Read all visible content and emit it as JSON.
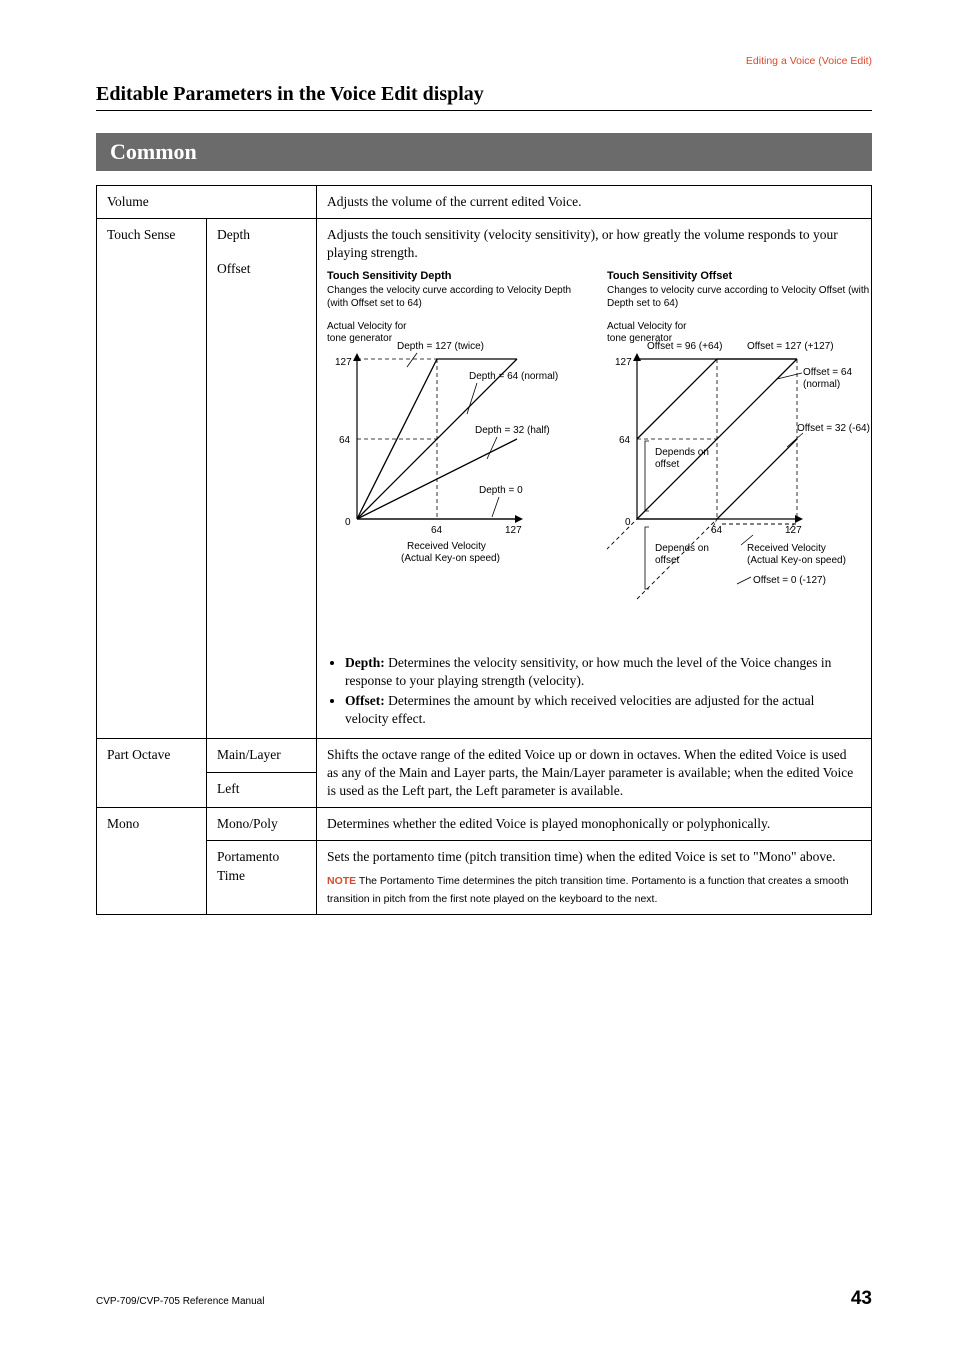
{
  "header": {
    "breadcrumb": "Editing a Voice (Voice Edit)"
  },
  "section_title": "Editable Parameters in the Voice Edit display",
  "common_bar": "Common",
  "table": {
    "volume": {
      "label": "Volume",
      "desc": "Adjusts the volume of the current edited Voice."
    },
    "touch_sense": {
      "label": "Touch Sense",
      "depth_label": "Depth",
      "offset_label": "Offset",
      "intro": "Adjusts the touch sensitivity (velocity sensitivity), or how greatly the volume responds to your playing strength.",
      "diag_left": {
        "title": "Touch Sensitivity Depth",
        "sub": "Changes the velocity curve according to Velocity Depth (with Offset set to 64)",
        "ylabel": "Actual Velocity for\ntone generator",
        "xlabel": "Received Velocity\n(Actual Key-on speed)",
        "ticks_y": [
          "127",
          "64",
          "0"
        ],
        "ticks_x": [
          "64",
          "127"
        ],
        "curves": [
          "Depth = 127 (twice)",
          "Depth = 64 (normal)",
          "Depth = 32 (half)",
          "Depth = 0"
        ]
      },
      "diag_right": {
        "title": "Touch Sensitivity Offset",
        "sub": "Changes to velocity curve according to Velocity Offset (with Depth set to 64)",
        "ylabel": "Actual Velocity for\ntone generator",
        "xlabel": "Received Velocity\n(Actual Key-on speed)",
        "ticks_y": [
          "127",
          "64",
          "0"
        ],
        "ticks_x": [
          "64",
          "127"
        ],
        "curves": [
          "Offset = 96 (+64)",
          "Offset = 127 (+127)",
          "Offset = 64 (normal)",
          "Offset = 32 (-64)",
          "Offset = 0 (-127)"
        ],
        "depends": "Depends on offset"
      },
      "bullets": {
        "depth_b": "Depth:",
        "depth_t": " Determines the velocity sensitivity, or how much the level of the Voice changes in response to your playing strength (velocity).",
        "offset_b": "Offset:",
        "offset_t": " Determines the amount by which received velocities are adjusted for the actual velocity effect."
      }
    },
    "part_octave": {
      "label": "Part Octave",
      "main_layer": "Main/Layer",
      "left": "Left",
      "desc": "Shifts the octave range of the edited Voice up or down in octaves. When the edited Voice is used as any of the Main and Layer parts, the Main/Layer parameter is available; when the edited Voice is used as the Left part, the Left parameter is available."
    },
    "mono": {
      "label": "Mono",
      "monopoly": "Mono/Poly",
      "monopoly_desc": "Determines whether the edited Voice is played monophonically or polyphonically.",
      "port": "Portamento Time",
      "port_desc": "Sets the portamento time (pitch transition time) when the edited Voice is set to \"Mono\" above.",
      "note_label": "NOTE",
      "note_body": " The Portamento Time determines the pitch transition time. Portamento is a function that creates a smooth transition in pitch from the first note played on the keyboard to the next."
    }
  },
  "footer": {
    "left": "CVP-709/CVP-705 Reference Manual",
    "right": "43"
  },
  "chart_data": [
    {
      "type": "line",
      "title": "Touch Sensitivity Depth",
      "subtitle": "Changes the velocity curve according to Velocity Depth (with Offset set to 64)",
      "xlabel": "Received Velocity (Actual Key-on speed)",
      "ylabel": "Actual Velocity for tone generator",
      "xlim": [
        0,
        127
      ],
      "ylim": [
        0,
        127
      ],
      "x": [
        0,
        64,
        127
      ],
      "series": [
        {
          "name": "Depth = 127 (twice)",
          "values": [
            0,
            127,
            127
          ]
        },
        {
          "name": "Depth = 64 (normal)",
          "values": [
            0,
            64,
            127
          ]
        },
        {
          "name": "Depth = 32 (half)",
          "values": [
            0,
            32,
            64
          ]
        },
        {
          "name": "Depth = 0",
          "values": [
            0,
            0,
            0
          ]
        }
      ]
    },
    {
      "type": "line",
      "title": "Touch Sensitivity Offset",
      "subtitle": "Changes to velocity curve according to Velocity Offset (with Depth set to 64)",
      "xlabel": "Received Velocity (Actual Key-on speed)",
      "ylabel": "Actual Velocity for tone generator",
      "xlim": [
        0,
        127
      ],
      "ylim": [
        0,
        127
      ],
      "x": [
        0,
        64,
        127
      ],
      "series": [
        {
          "name": "Offset = 127 (+127)",
          "values": [
            127,
            127,
            127
          ]
        },
        {
          "name": "Offset = 96 (+64)",
          "values": [
            64,
            127,
            127
          ]
        },
        {
          "name": "Offset = 64 (normal)",
          "values": [
            0,
            64,
            127
          ]
        },
        {
          "name": "Offset = 32 (-64)",
          "values": [
            0,
            0,
            64
          ]
        },
        {
          "name": "Offset = 0 (-127)",
          "values": [
            0,
            0,
            0
          ]
        }
      ],
      "annotations": [
        "Depends on offset"
      ]
    }
  ]
}
